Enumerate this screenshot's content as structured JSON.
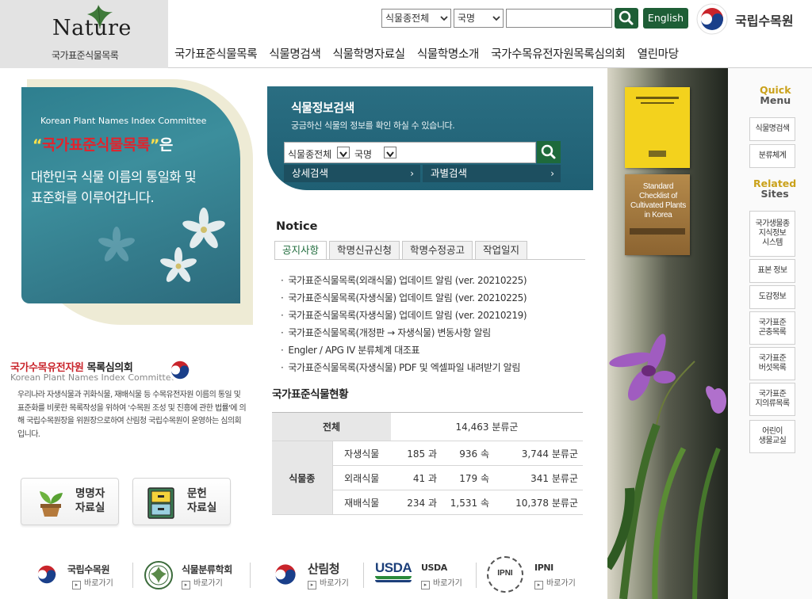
{
  "header": {
    "logo_word": "Nature",
    "logo_sub": "국가표준식물목록",
    "search_scope": "식물종전체",
    "search_field": "국명",
    "search_placeholder": "",
    "english_label": "English",
    "institution_name": "국립수목원",
    "nav": [
      "국가표준식물목록",
      "식물명검색",
      "식물학명자료실",
      "식물학명소개",
      "국가수목유전자원목록심의회",
      "열린마당"
    ]
  },
  "banner": {
    "org_en": "Korean Plant Names Index Committee",
    "title_q_open": "“",
    "title_main": "국가표준식물목록",
    "title_q_close": "”",
    "title_suffix": "은",
    "line1": "대한민국 식물 이름의 통일화 및",
    "line2": "표준화를 이루어갑니다."
  },
  "committee": {
    "title_red": "국가수목유전자원",
    "title_rest": " 목록심의회",
    "title_en": "Korean Plant Names Index Committee",
    "description": "우리나라 자생식물과 귀화식물, 재배식물 등 수목유전자원 이름의 통일 및 표준화를 비롯한 목록작성을 위하여 '수목원 조성 및 진흥에 관한 법률'에 의해 국립수목원장을 위원장으로하여 산림청 국립수목원이 운영하는 심의회입니다."
  },
  "big_buttons": {
    "namer": [
      "명명자",
      "자료실"
    ],
    "literature": [
      "문헌",
      "자료실"
    ]
  },
  "search_panel": {
    "title": "식물정보검색",
    "subtitle": "궁금하신 식물의 정보를 확인 하실 수 있습니다.",
    "scope": "식물종전체",
    "field": "국명",
    "detail_label": "상세검색",
    "family_label": "과별검색",
    "arrow": "›"
  },
  "notice": {
    "title": "Notice",
    "tabs": [
      "공지사항",
      "학명신규신청",
      "학명수정공고",
      "작업일지"
    ],
    "bullet": "·",
    "items": [
      "국가표준식물목록(외래식물) 업데이트 알림 (ver. 20210225)",
      "국가표준식물목록(자생식물) 업데이트 알림 (ver. 20210225)",
      "국가표준식물목록(자생식물) 업데이트 알림 (ver. 20210219)",
      "국가표준식물목록(개정판 → 자생식물) 변동사항 알림",
      "Engler / APG IV 분류체계 대조표",
      "국가표준식물목록(자생식물) PDF 및 엑셀파일 내려받기 알림"
    ]
  },
  "status": {
    "title": "국가표준식물현황",
    "total_label": "전체",
    "total_value": "14,463 분류군",
    "group_label": "식물종",
    "rows": [
      {
        "label": "자생식물",
        "family": "185 과",
        "genus": "936 속",
        "taxa": "3,744 분류군"
      },
      {
        "label": "외래식물",
        "family": "41 과",
        "genus": "179 속",
        "taxa": "341 분류군"
      },
      {
        "label": "재배식물",
        "family": "234 과",
        "genus": "1,531 속",
        "taxa": "10,378 분류군"
      }
    ]
  },
  "books": {
    "brown_title": "Standard Checklist of Cultivated Plants in Korea"
  },
  "quick_menu": {
    "title_top": "Quick",
    "title_bottom": "Menu",
    "items": [
      "식물명검색",
      "분류체계"
    ],
    "related_top": "Related",
    "related_bottom": "Sites",
    "related_items": [
      [
        "국가생물종",
        "지식정보",
        "시스템"
      ],
      [
        "표본 정보"
      ],
      [
        "도감정보"
      ],
      [
        "국가표준",
        "곤충목록"
      ],
      [
        "국가표준",
        "버섯목록"
      ],
      [
        "국가표준",
        "지의류목록"
      ],
      [
        "어린이",
        "생물교실"
      ]
    ]
  },
  "footer_links": [
    {
      "name": "국립수목원",
      "go": "바로가기"
    },
    {
      "name": "식물분류학회",
      "go": "바로가기"
    },
    {
      "name": "산림청",
      "go": "바로가기"
    },
    {
      "name": "USDA",
      "go": "바로가기",
      "logo_text": "USDA"
    },
    {
      "name": "IPNI",
      "go": "바로가기",
      "logo_text": "IPNI"
    }
  ],
  "go_icon": "▸",
  "colors": {
    "brand_green": "#1e5e36",
    "panel_teal": "#2a6e82",
    "accent_gold": "#caa11a",
    "accent_red": "#c9242b"
  }
}
